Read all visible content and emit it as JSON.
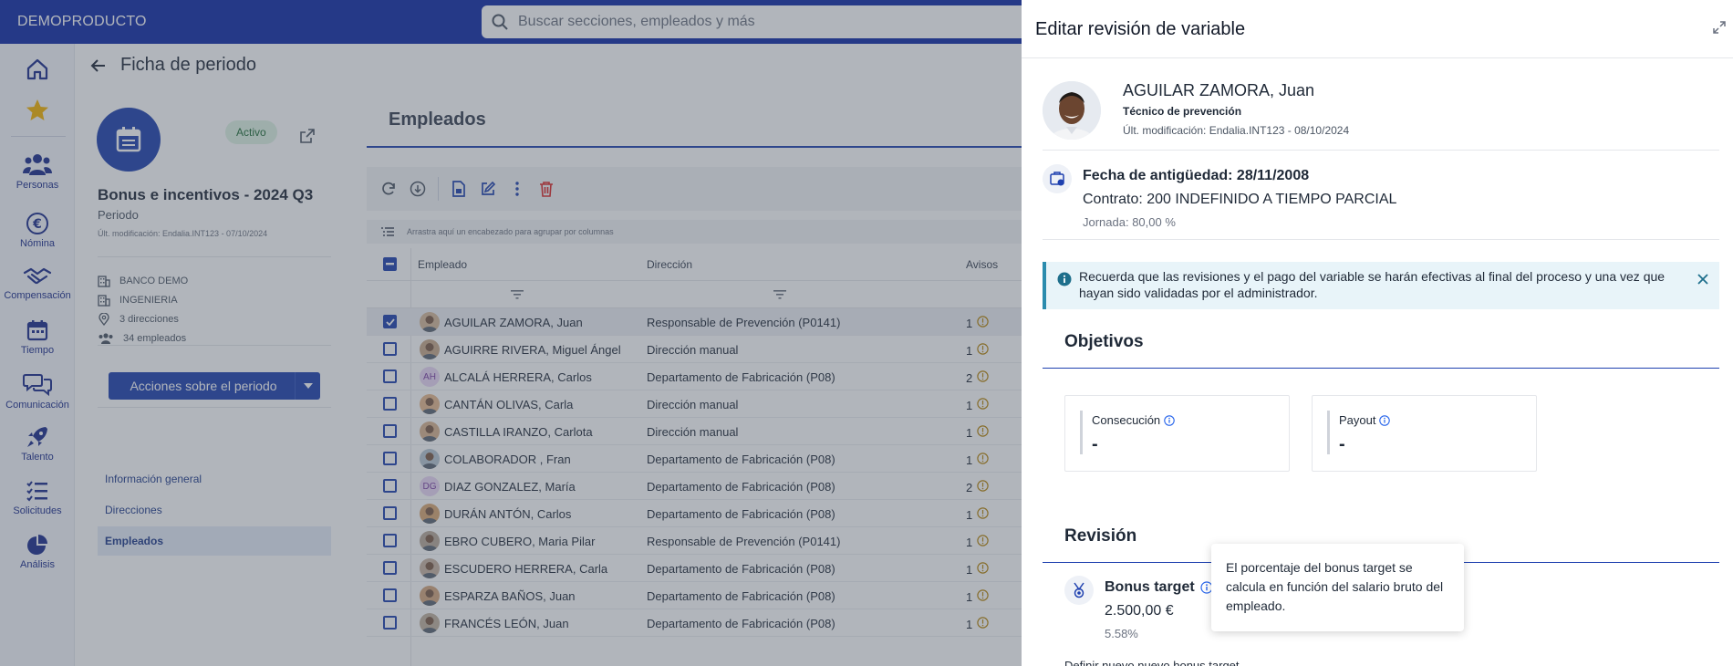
{
  "brand": "DEMOPRODUCTO",
  "search": {
    "placeholder": "Buscar secciones, empleados y más"
  },
  "rail": [
    {
      "label": "",
      "icon": "home-icon"
    },
    {
      "label": "",
      "icon": "star-icon"
    },
    {
      "label": "Personas",
      "icon": "people-icon"
    },
    {
      "label": "Nómina",
      "icon": "euro-icon"
    },
    {
      "label": "Compensación",
      "icon": "handshake-icon"
    },
    {
      "label": "Tiempo",
      "icon": "calendar-icon"
    },
    {
      "label": "Comunicación",
      "icon": "chat-icon"
    },
    {
      "label": "Talento",
      "icon": "rocket-icon"
    },
    {
      "label": "Solicitudes",
      "icon": "list-icon"
    },
    {
      "label": "Análisis",
      "icon": "pie-chart-icon"
    }
  ],
  "period": {
    "page_title": "Ficha de periodo",
    "status": "Activo",
    "name": "Bonus e incentivos - 2024 Q3",
    "type": "Periodo",
    "last_mod": "Últ. modificación: Endalia.INT123 - 07/10/2024",
    "info": [
      "BANCO DEMO",
      "INGENIERIA",
      "3 direcciones",
      "34 empleados"
    ],
    "actions_label": "Acciones sobre el periodo",
    "nav": [
      "Información general",
      "Direcciones",
      "Empleados"
    ]
  },
  "employees": {
    "title": "Empleados",
    "group_hint": "Arrastra aquí un encabezado para agrupar por columnas",
    "columns": [
      "Empleado",
      "Dirección",
      "Avisos"
    ],
    "rows": [
      {
        "name": "AGUILAR ZAMORA, Juan",
        "direction": "Responsable de Prevención (P0141)",
        "avisos": "1",
        "initials": "",
        "selected": true
      },
      {
        "name": "AGUIRRE RIVERA, Miguel Ángel",
        "direction": "Dirección manual",
        "avisos": "1",
        "initials": "",
        "selected": false
      },
      {
        "name": "ALCALÁ HERRERA, Carlos",
        "direction": "Departamento de Fabricación (P08)",
        "avisos": "2",
        "initials": "AH",
        "selected": false
      },
      {
        "name": "CANTÁN OLIVAS, Carla",
        "direction": "Dirección manual",
        "avisos": "1",
        "initials": "",
        "selected": false
      },
      {
        "name": "CASTILLA IRANZO, Carlota",
        "direction": "Dirección manual",
        "avisos": "1",
        "initials": "",
        "selected": false
      },
      {
        "name": "COLABORADOR , Fran",
        "direction": "Departamento de Fabricación (P08)",
        "avisos": "1",
        "initials": "",
        "selected": false
      },
      {
        "name": "DIAZ GONZALEZ, María",
        "direction": "Departamento de Fabricación (P08)",
        "avisos": "2",
        "initials": "DG",
        "selected": false
      },
      {
        "name": "DURÁN ANTÓN, Carlos",
        "direction": "Departamento de Fabricación (P08)",
        "avisos": "1",
        "initials": "",
        "selected": false
      },
      {
        "name": "EBRO CUBERO, Maria Pilar",
        "direction": "Responsable de Prevención (P0141)",
        "avisos": "1",
        "initials": "",
        "selected": false
      },
      {
        "name": "ESCUDERO HERRERA, Carla",
        "direction": "Departamento de Fabricación (P08)",
        "avisos": "1",
        "initials": "",
        "selected": false
      },
      {
        "name": "ESPARZA BAÑOS, Juan",
        "direction": "Departamento de Fabricación (P08)",
        "avisos": "1",
        "initials": "",
        "selected": false
      },
      {
        "name": "FRANCÉS LEÓN, Juan",
        "direction": "Departamento de Fabricación (P08)",
        "avisos": "1",
        "initials": "",
        "selected": false
      }
    ]
  },
  "drawer": {
    "title": "Editar revisión de variable",
    "person": {
      "name": "AGUILAR ZAMORA, Juan",
      "role": "Técnico de prevención",
      "last_mod": "Últ. modificación: Endalia.INT123 - 08/10/2024"
    },
    "seniority": "Fecha de antigüedad: 28/11/2008",
    "contract": "Contrato: 200 INDEFINIDO A TIEMPO PARCIAL",
    "jornada": "Jornada: 80,00 %",
    "alert": "Recuerda que las revisiones y el pago del variable se harán efectivas al final del proceso y una vez que hayan sido validadas por el administrador.",
    "objectives_title": "Objetivos",
    "consecucion": {
      "label": "Consecución",
      "value": "-"
    },
    "payout": {
      "label": "Payout",
      "value": "-"
    },
    "revision_title": "Revisión",
    "bonus": {
      "label": "Bonus target",
      "value": "2.500,00 €",
      "pct": "5.58%"
    },
    "tooltip": "El porcentaje del bonus target se calcula en función del salario bruto del empleado.",
    "cut_text": "Definir nuevo nuevo bonus target"
  },
  "colors": {
    "primary": "#1e40af",
    "topbar": "#0f2aa6",
    "warning": "#b7860b",
    "danger": "#dc2626",
    "info": "#2b8cae"
  }
}
